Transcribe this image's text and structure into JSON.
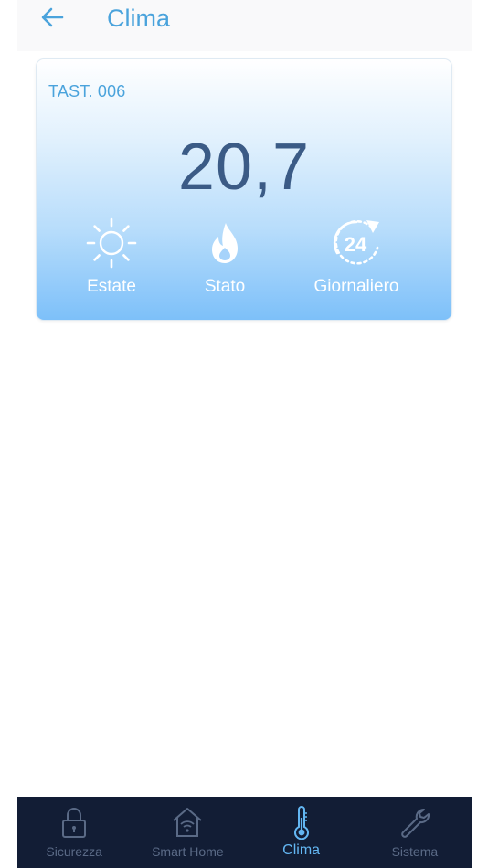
{
  "header": {
    "title": "Clima",
    "back_icon": "arrow-left-icon"
  },
  "card": {
    "label": "TAST. 006",
    "temperature": "20,7",
    "controls": [
      {
        "icon": "sun-icon",
        "label": "Estate"
      },
      {
        "icon": "flame-icon",
        "label": "Stato"
      },
      {
        "icon": "clock-24-icon",
        "label": "Giornaliero"
      }
    ]
  },
  "bottom_nav": {
    "active": "Clima",
    "items": [
      {
        "icon": "lock-icon",
        "label": "Sicurezza"
      },
      {
        "icon": "smart-home-icon",
        "label": "Smart Home"
      },
      {
        "icon": "thermometer-icon",
        "label": "Clima"
      },
      {
        "icon": "wrench-icon",
        "label": "Sistema"
      }
    ]
  },
  "colors": {
    "accent": "#4aa3dc",
    "temperature_text": "#3b5b86",
    "nav_background": "#121d35",
    "nav_inactive": "#5a6a86",
    "nav_active": "#63b6f2"
  }
}
